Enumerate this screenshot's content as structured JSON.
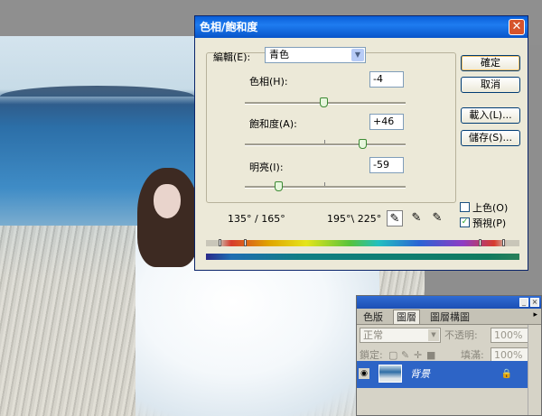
{
  "dialog": {
    "title": "色相/飽和度",
    "close_glyph": "✕",
    "edit_label": "編輯(E):",
    "edit_value": "青色",
    "hue": {
      "label": "色相(H):",
      "value": "-4",
      "position": 0.49
    },
    "saturation": {
      "label": "飽和度(A):",
      "value": "+46",
      "position": 0.73
    },
    "lightness": {
      "label": "明亮(I):",
      "value": "-59",
      "position": 0.21
    },
    "range_left": "135° / 165°",
    "range_right": "195°\\ 225°",
    "buttons": {
      "ok": "確定",
      "cancel": "取消",
      "load": "載入(L)...",
      "save": "儲存(S)..."
    },
    "colorize": {
      "label": "上色(O)",
      "checked": false
    },
    "preview": {
      "label": "預視(P)",
      "checked": true
    },
    "eyedroppers": [
      "eyedropper-icon",
      "eyedropper-plus-icon",
      "eyedropper-minus-icon"
    ],
    "accent_color": "#0a5fd8",
    "close_color": "#d6542c"
  },
  "layers_panel": {
    "tabs": [
      "色版",
      "圖層",
      "圖層構圖"
    ],
    "active_tab": "圖層",
    "blend_mode": "正常",
    "opacity_label": "不透明:",
    "opacity_value": "100%",
    "lock_label": "鎖定:",
    "fill_label": "填滿:",
    "fill_value": "100%",
    "layer_name": "背景",
    "accent_color": "#2d64c6"
  }
}
